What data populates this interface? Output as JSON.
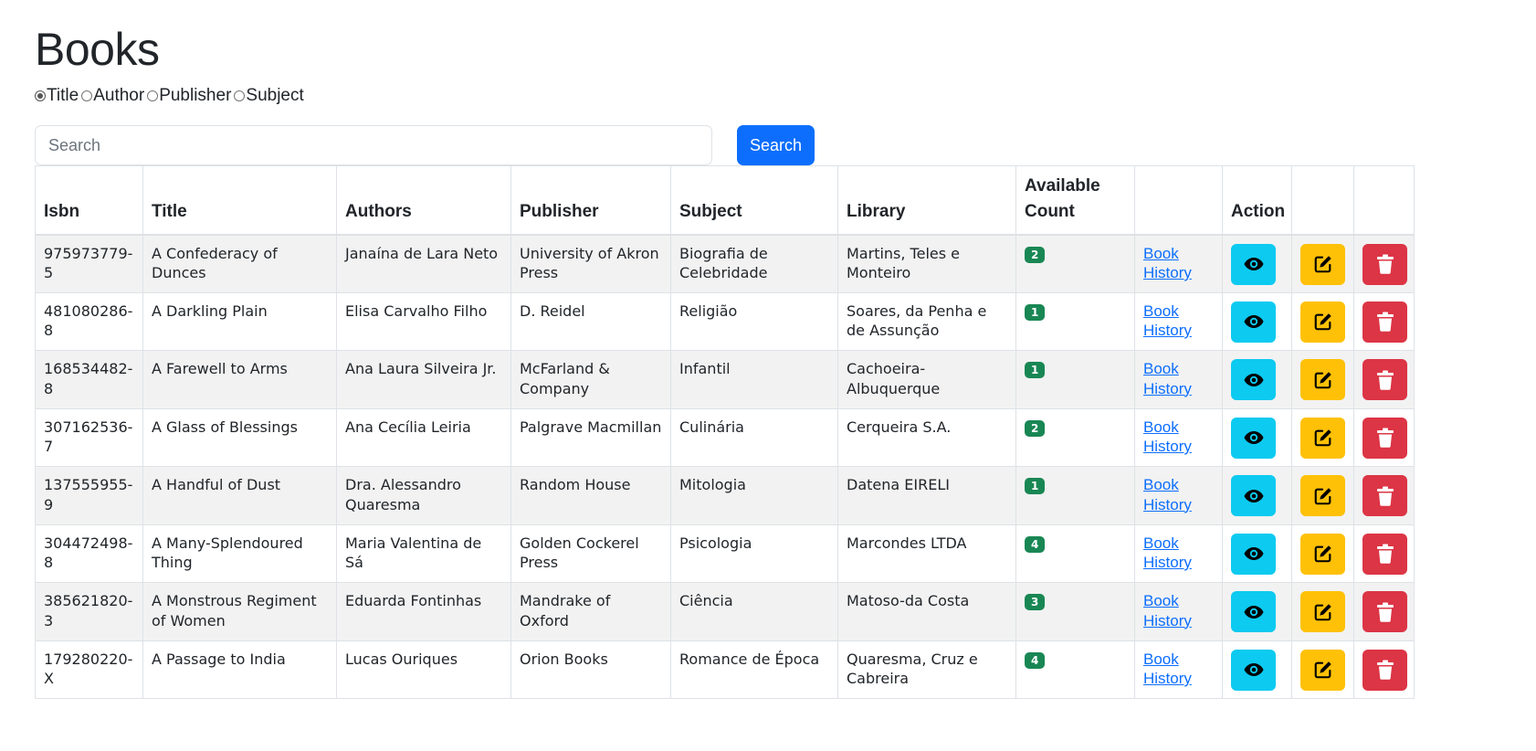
{
  "page": {
    "title": "Books"
  },
  "search": {
    "mode_options": [
      {
        "label": "Title",
        "checked": true
      },
      {
        "label": "Author",
        "checked": false
      },
      {
        "label": "Publisher",
        "checked": false
      },
      {
        "label": "Subject",
        "checked": false
      }
    ],
    "placeholder": "Search",
    "value": "",
    "button_label": "Search"
  },
  "table": {
    "headers": {
      "isbn": "Isbn",
      "title": "Title",
      "authors": "Authors",
      "publisher": "Publisher",
      "subject": "Subject",
      "library": "Library",
      "available_count": "Available Count",
      "history": "",
      "action": "Action"
    },
    "history_link_label": "Book History",
    "row_icons": {
      "view": "eye-icon",
      "edit": "edit-icon",
      "delete": "trash-icon"
    },
    "rows": [
      {
        "isbn": "975973779-5",
        "title": "A Confederacy of Dunces",
        "authors": "Janaína de Lara Neto",
        "publisher": "University of Akron Press",
        "subject": "Biografia de Celebridade",
        "library": "Martins, Teles e Monteiro",
        "available": "2"
      },
      {
        "isbn": "481080286-8",
        "title": "A Darkling Plain",
        "authors": "Elisa Carvalho Filho",
        "publisher": "D. Reidel",
        "subject": "Religião",
        "library": "Soares, da Penha e de Assunção",
        "available": "1"
      },
      {
        "isbn": "168534482-8",
        "title": "A Farewell to Arms",
        "authors": "Ana Laura Silveira Jr.",
        "publisher": "McFarland & Company",
        "subject": "Infantil",
        "library": "Cachoeira-Albuquerque",
        "available": "1"
      },
      {
        "isbn": "307162536-7",
        "title": "A Glass of Blessings",
        "authors": "Ana Cecília Leiria",
        "publisher": "Palgrave Macmillan",
        "subject": "Culinária",
        "library": "Cerqueira S.A.",
        "available": "2"
      },
      {
        "isbn": "137555955-9",
        "title": "A Handful of Dust",
        "authors": "Dra. Alessandro Quaresma",
        "publisher": "Random House",
        "subject": "Mitologia",
        "library": "Datena EIRELI",
        "available": "1"
      },
      {
        "isbn": "304472498-8",
        "title": "A Many-Splendoured Thing",
        "authors": "Maria Valentina de Sá",
        "publisher": "Golden Cockerel Press",
        "subject": "Psicologia",
        "library": "Marcondes LTDA",
        "available": "4"
      },
      {
        "isbn": "385621820-3",
        "title": "A Monstrous Regiment of Women",
        "authors": "Eduarda Fontinhas",
        "publisher": "Mandrake of Oxford",
        "subject": "Ciência",
        "library": "Matoso-da Costa",
        "available": "3"
      },
      {
        "isbn": "179280220-X",
        "title": "A Passage to India",
        "authors": "Lucas Ouriques",
        "publisher": "Orion Books",
        "subject": "Romance de Época",
        "library": "Quaresma, Cruz e Cabreira",
        "available": "4"
      }
    ]
  },
  "colors": {
    "primary": "#0d6efd",
    "info": "#0dcaf0",
    "warning": "#ffc107",
    "danger": "#dc3545",
    "success": "#198754"
  }
}
